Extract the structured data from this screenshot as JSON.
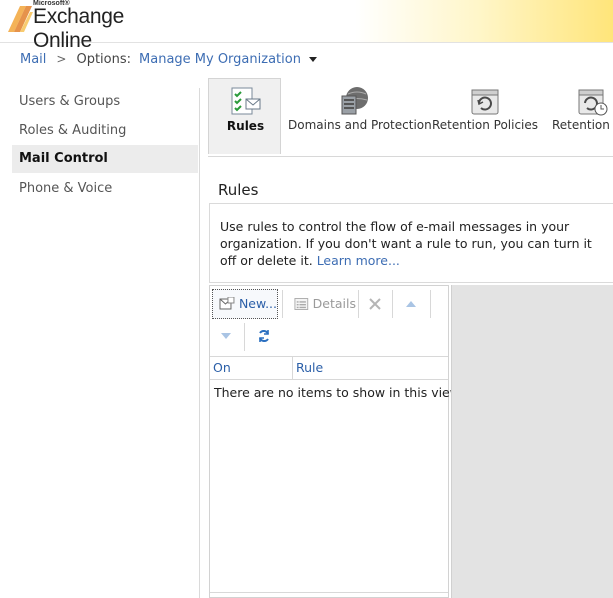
{
  "header": {
    "brand_small": "Microsoft®",
    "app_name": "Exchange Online"
  },
  "breadcrumb": {
    "root": "Mail",
    "options_label": "Options:",
    "current": "Manage My Organization"
  },
  "leftnav": {
    "items": [
      {
        "label": "Users & Groups",
        "selected": false
      },
      {
        "label": "Roles & Auditing",
        "selected": false
      },
      {
        "label": "Mail Control",
        "selected": true
      },
      {
        "label": "Phone & Voice",
        "selected": false
      }
    ]
  },
  "tabs": [
    {
      "label": "Rules",
      "icon": "rules-icon",
      "selected": true
    },
    {
      "label": "Domains and Protection",
      "icon": "domains-protection-icon",
      "selected": false
    },
    {
      "label": "Retention Policies",
      "icon": "retention-policies-icon",
      "selected": false
    },
    {
      "label": "Retention T",
      "icon": "retention-tags-icon",
      "selected": false
    }
  ],
  "content": {
    "title": "Rules",
    "description": "Use rules to control the flow of e-mail messages in your organization. If you don't want a rule to run, you can turn it off or delete it.",
    "learn_more": "Learn more..."
  },
  "toolbar": {
    "new_label": "New...",
    "details_label": "Details"
  },
  "grid": {
    "columns": [
      "On",
      "Rule"
    ],
    "empty_message": "There are no items to show in this view."
  },
  "colors": {
    "link": "#3d6db3",
    "header_gradient_end": "#ffe57a",
    "selected_bg": "#ececec"
  }
}
